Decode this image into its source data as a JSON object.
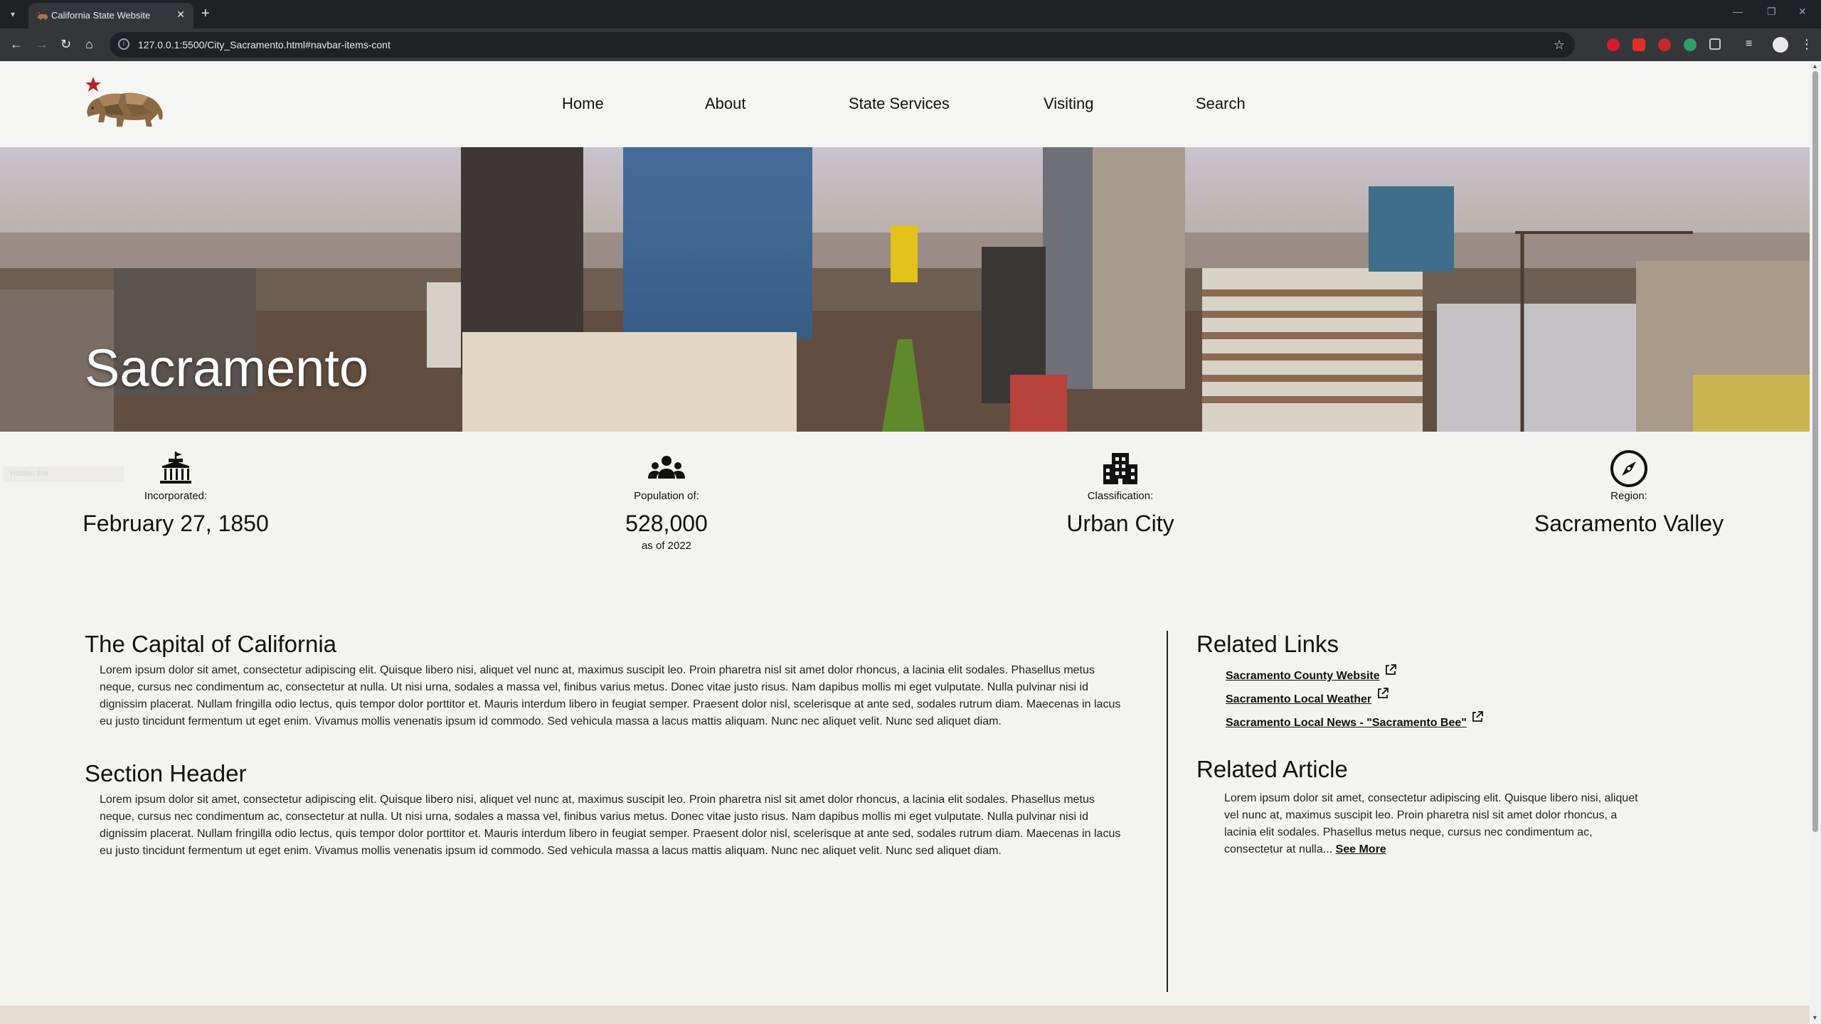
{
  "browser": {
    "tab_title": "California State Website",
    "url": "127.0.0.1:5500/City_Sacramento.html#navbar-items-cont"
  },
  "nav": [
    "Home",
    "About",
    "State Services",
    "Visiting",
    "Search"
  ],
  "hero": {
    "title": "Sacramento"
  },
  "stats": [
    {
      "icon": "capitol-icon",
      "label": "Incorporated:",
      "value": "February 27, 1850",
      "sub": ""
    },
    {
      "icon": "people-icon",
      "label": "Population of:",
      "value": "528,000",
      "sub": "as of 2022"
    },
    {
      "icon": "buildings-icon",
      "label": "Classification:",
      "value": "Urban City",
      "sub": ""
    },
    {
      "icon": "compass-icon",
      "label": "Region:",
      "value": "Sacramento Valley",
      "sub": ""
    }
  ],
  "hidden_label": "Hidden link",
  "sections": [
    {
      "heading": "The Capital of California",
      "body": "Lorem ipsum dolor sit amet, consectetur adipiscing elit. Quisque libero nisi, aliquet vel nunc at, maximus suscipit leo. Proin pharetra nisl sit amet dolor rhoncus, a lacinia elit sodales. Phasellus metus neque, cursus nec condimentum ac, consectetur at nulla. Ut nisi urna, sodales a massa vel, finibus varius metus. Donec vitae justo risus. Nam dapibus mollis mi eget vulputate. Nulla pulvinar nisi id dignissim placerat. Nullam fringilla odio lectus, quis tempor dolor porttitor et. Mauris interdum libero in feugiat semper. Praesent dolor nisl, scelerisque at ante sed, sodales rutrum diam. Maecenas in lacus eu justo tincidunt fermentum ut eget enim. Vivamus mollis venenatis ipsum id commodo. Sed vehicula massa a lacus mattis aliquam. Nunc nec aliquet velit. Nunc sed aliquet diam."
    },
    {
      "heading": "Section Header",
      "body": "Lorem ipsum dolor sit amet, consectetur adipiscing elit. Quisque libero nisi, aliquet vel nunc at, maximus suscipit leo. Proin pharetra nisl sit amet dolor rhoncus, a lacinia elit sodales. Phasellus metus neque, cursus nec condimentum ac, consectetur at nulla. Ut nisi urna, sodales a massa vel, finibus varius metus. Donec vitae justo risus. Nam dapibus mollis mi eget vulputate. Nulla pulvinar nisi id dignissim placerat. Nullam fringilla odio lectus, quis tempor dolor porttitor et. Mauris interdum libero in feugiat semper. Praesent dolor nisl, scelerisque at ante sed, sodales rutrum diam. Maecenas in lacus eu justo tincidunt fermentum ut eget enim. Vivamus mollis venenatis ipsum id commodo. Sed vehicula massa a lacus mattis aliquam. Nunc nec aliquet velit. Nunc sed aliquet diam."
    }
  ],
  "related_links": {
    "heading": "Related Links",
    "items": [
      "Sacramento County Website",
      "Sacramento Local Weather",
      "Sacramento Local News - \"Sacramento Bee\""
    ]
  },
  "related_article": {
    "heading": "Related Article",
    "body": "Lorem ipsum dolor sit amet, consectetur adipiscing elit. Quisque libero nisi, aliquet vel nunc at, maximus suscipit leo. Proin pharetra nisl sit amet dolor rhoncus, a lacinia elit sodales. Phasellus metus neque, cursus nec condimentum ac, consectetur at nulla...",
    "see_more": "See More"
  },
  "colors": {
    "page_bg": "#f3f3f0",
    "browser_dark": "#202124",
    "browser_toolbar": "#35363a",
    "logo_star": "#b5202e",
    "logo_bear": "#8a6a45"
  }
}
